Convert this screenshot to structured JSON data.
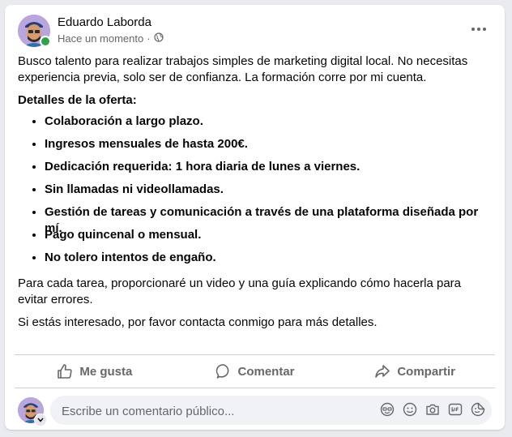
{
  "post": {
    "author": "Eduardo Laborda",
    "timestamp": "Hace un momento",
    "separator": "·",
    "audience_icon": "globe-icon",
    "intro": "Busco talento para realizar trabajos simples de marketing digital local. No necesitas experiencia previa, solo ser de confianza. La formación corre por mi cuenta.",
    "details_heading": "Detalles de la oferta:",
    "details": [
      "Colaboración a largo plazo.",
      "Ingresos mensuales de hasta 200€.",
      "Dedicación requerida: 1 hora diaria de lunes a viernes.",
      "Sin llamadas ni videollamadas.",
      "Gestión de tareas y comunicación a través de una plataforma diseñada por mí.",
      "Pago quincenal o mensual.",
      "No tolero intentos de engaño."
    ],
    "closing_1": "Para cada tarea, proporcionaré un video y una guía explicando cómo hacerla para evitar errores.",
    "closing_2": "Si estás interesado, por favor contacta conmigo para más detalles."
  },
  "actions": {
    "like": "Me gusta",
    "comment": "Comentar",
    "share": "Compartir"
  },
  "comment": {
    "placeholder": "Escribe un comentario público...",
    "icons": [
      "avatar-sticker-icon",
      "emoji-icon",
      "camera-icon",
      "gif-icon",
      "sticker-icon"
    ]
  },
  "colors": {
    "online": "#31a24c",
    "secondary_text": "#65676b",
    "comment_bg": "#f0f2f5"
  }
}
